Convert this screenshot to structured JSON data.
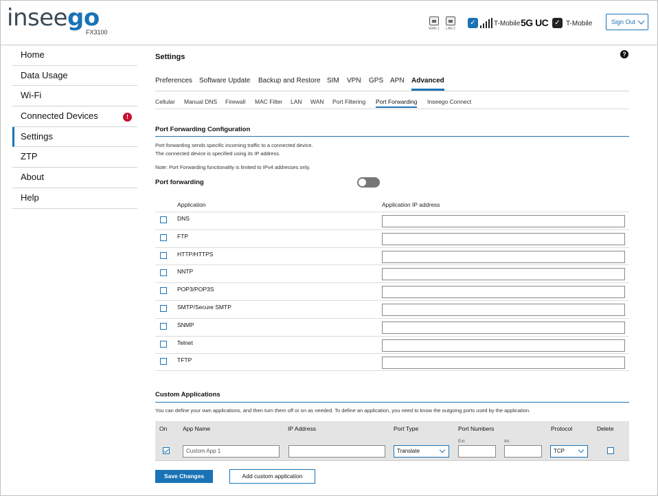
{
  "header": {
    "logo_prefix": "insee",
    "logo_suffix": "go",
    "model": "FX3100",
    "wan1_label": "WAN 1",
    "wan2_label": "LAN 2",
    "carrier1": "T-Mobile",
    "network_type": "5G UC",
    "carrier2": "T-Mobile",
    "sign_out": "Sign Out"
  },
  "sidebar": {
    "items": [
      {
        "label": "Home"
      },
      {
        "label": "Data Usage"
      },
      {
        "label": "Wi-Fi"
      },
      {
        "label": "Connected Devices",
        "badge": "!"
      },
      {
        "label": "Settings"
      },
      {
        "label": "ZTP"
      },
      {
        "label": "About"
      },
      {
        "label": "Help"
      }
    ],
    "active": "Settings"
  },
  "main": {
    "title": "Settings",
    "help": "?",
    "tabs": [
      "Preferences",
      "Software Update",
      "Backup and Restore",
      "SIM",
      "VPN",
      "GPS",
      "APN",
      "Advanced"
    ],
    "active_tab": "Advanced",
    "subtabs": [
      "Cellular",
      "Manual DNS",
      "Firewall",
      "MAC Filter",
      "LAN",
      "WAN",
      "Port Filtering",
      "Port Forwarding",
      "Inseego Connect"
    ],
    "active_subtab": "Port Forwarding"
  },
  "port_forwarding": {
    "section_title": "Port Forwarding Configuration",
    "desc1": "Port forwarding sends specific incoming traffic to a connected device.",
    "desc2": "The connected device is specified using its IP address.",
    "note": "Note: Port Forwarding functionality is limited to IPv4 addresses only.",
    "toggle_label": "Port forwarding",
    "toggle_on": false,
    "col_application": "Application",
    "col_ip": "Application IP address",
    "apps": [
      {
        "name": "DNS",
        "checked": false,
        "ip": ""
      },
      {
        "name": "FTP",
        "checked": false,
        "ip": ""
      },
      {
        "name": "HTTP/HTTPS",
        "checked": false,
        "ip": ""
      },
      {
        "name": "NNTP",
        "checked": false,
        "ip": ""
      },
      {
        "name": "POP3/POP3S",
        "checked": false,
        "ip": ""
      },
      {
        "name": "SMTP/Secure SMTP",
        "checked": false,
        "ip": ""
      },
      {
        "name": "SNMP",
        "checked": false,
        "ip": ""
      },
      {
        "name": "Telnet",
        "checked": false,
        "ip": ""
      },
      {
        "name": "TFTP",
        "checked": false,
        "ip": ""
      }
    ]
  },
  "custom": {
    "section_title": "Custom Applications",
    "desc": "You can define your own applications, and then turn them off or on as needed. To define an application, you need to know the outgoing ports used by the application.",
    "headers": {
      "on": "On",
      "app_name": "App Name",
      "ip": "IP Address",
      "port_type": "Port Type",
      "port_numbers": "Port Numbers",
      "ext": "Ext",
      "int": "Int",
      "protocol": "Protocol",
      "delete": "Delete"
    },
    "row": {
      "on": true,
      "app_name_placeholder": "Custom App 1",
      "ip": "",
      "port_type": "Translate",
      "ext": "",
      "int": "",
      "protocol": "TCP",
      "delete": false
    },
    "save_label": "Save Changes",
    "add_label": "Add custom application"
  }
}
